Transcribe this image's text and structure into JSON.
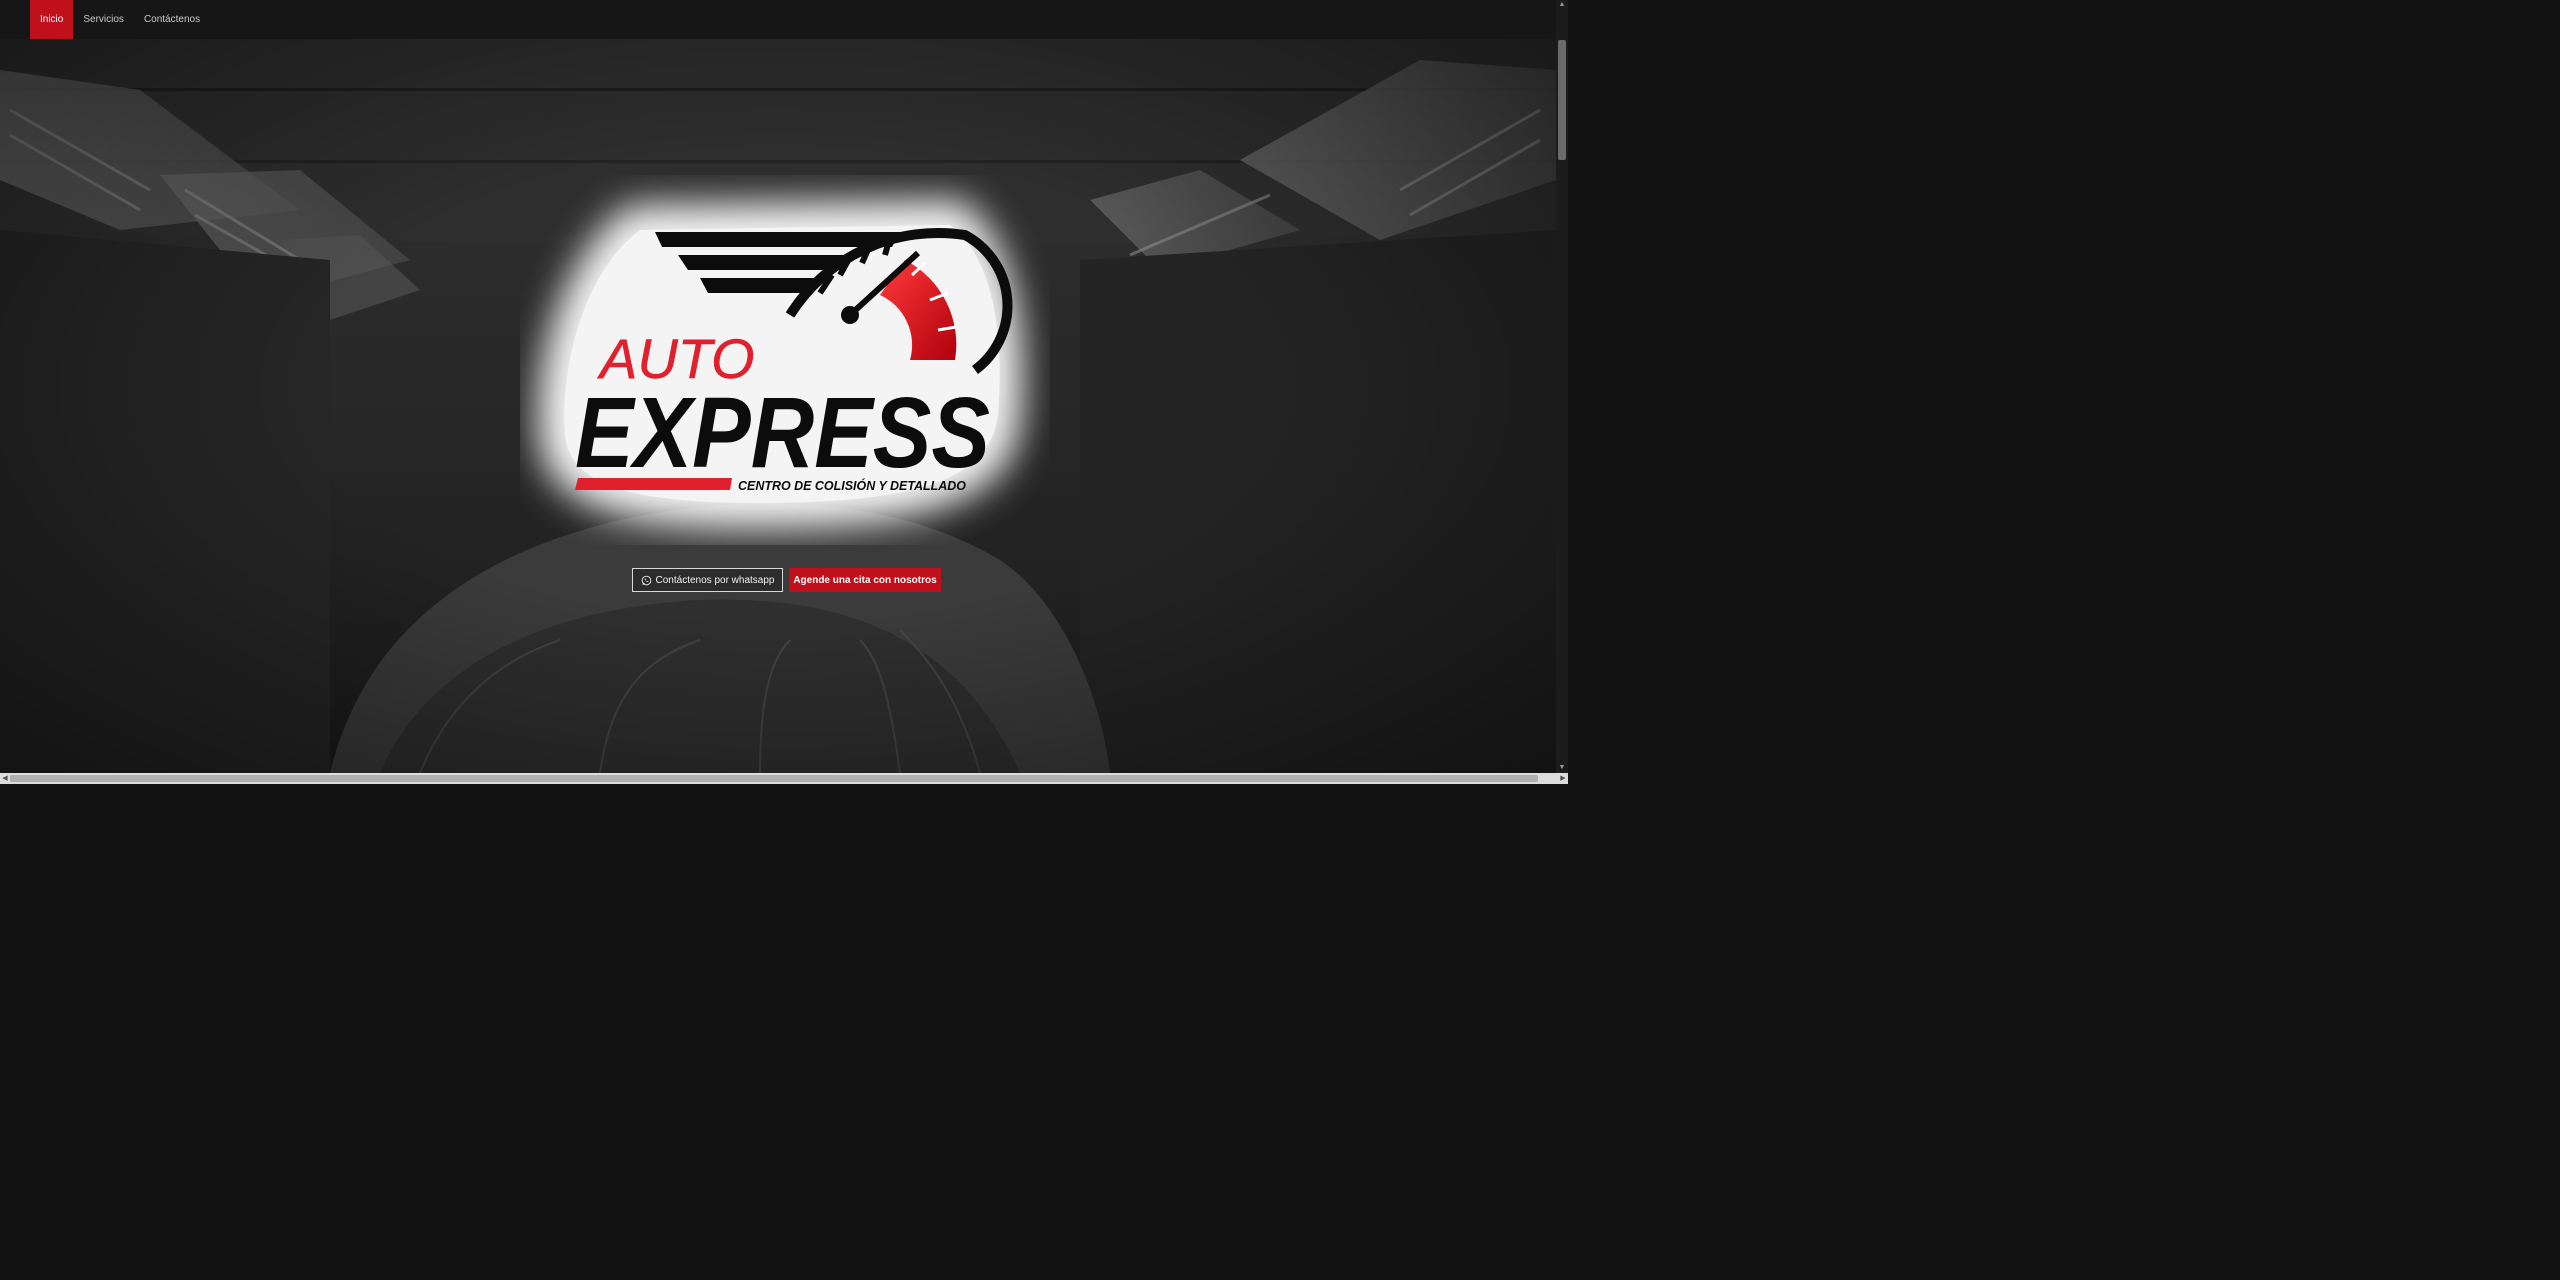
{
  "nav": {
    "items": [
      {
        "label": "Inicio",
        "active": true
      },
      {
        "label": "Servicios",
        "active": false
      },
      {
        "label": "Contáctenos",
        "active": false
      }
    ]
  },
  "hero": {
    "logo": {
      "word_top": "AUTO",
      "word_main": "EXPRESS",
      "tagline": "CENTRO DE COLISIÓN Y DETALLADO"
    },
    "buttons": {
      "whatsapp_label": "Contáctenos por whatsapp",
      "whatsapp_icon": "whatsapp-icon",
      "appointment_label": "Agende una cita con nosotros"
    }
  },
  "colors": {
    "accent": "#c0101c",
    "navbar": "#161616",
    "logo_red": "#e0202c"
  }
}
